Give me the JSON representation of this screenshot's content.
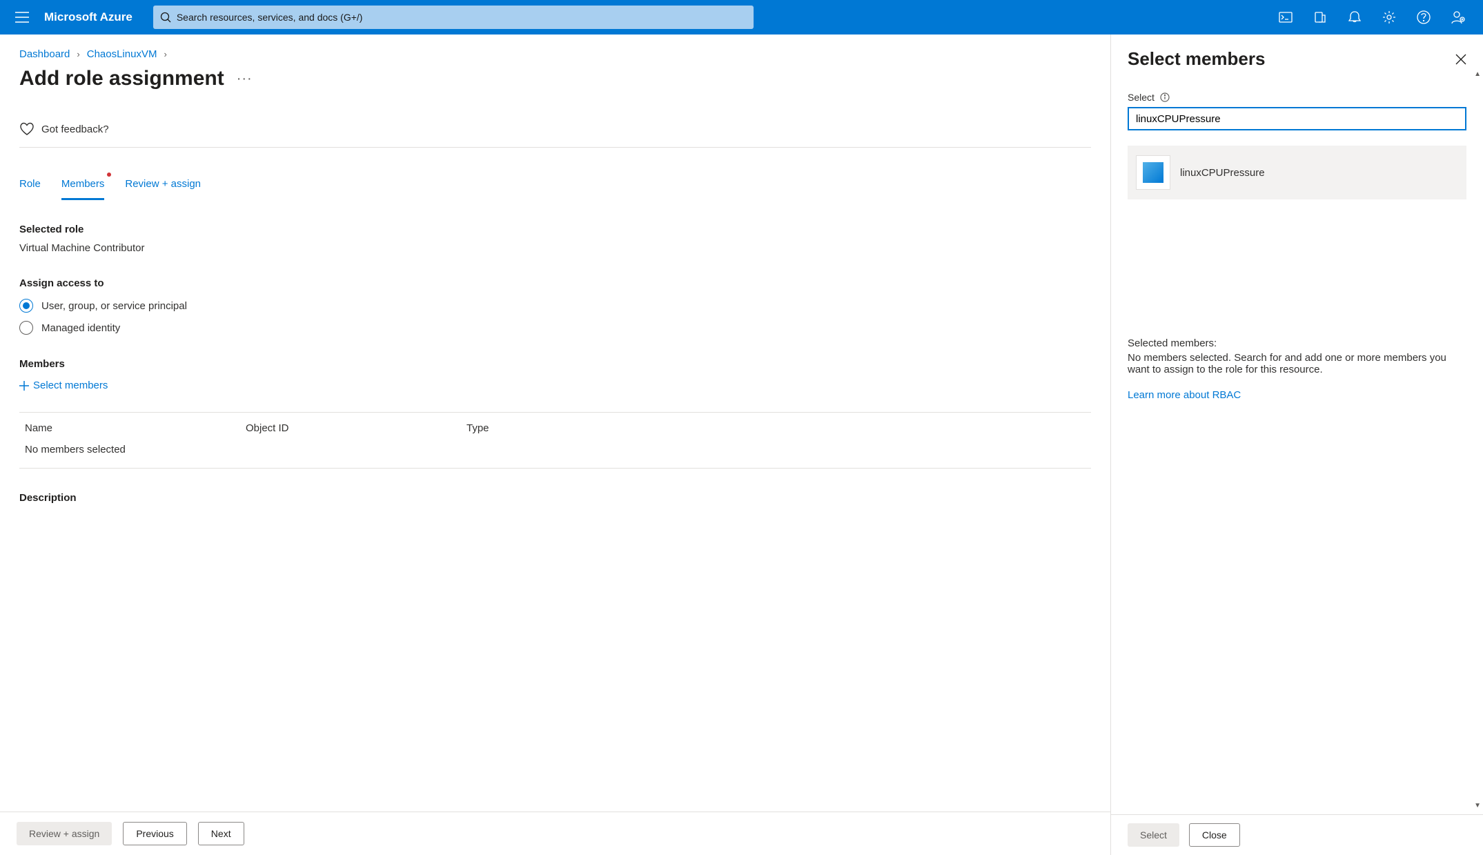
{
  "topbar": {
    "logo": "Microsoft Azure",
    "search_placeholder": "Search resources, services, and docs (G+/)"
  },
  "breadcrumbs": {
    "items": [
      "Dashboard",
      "ChaosLinuxVM"
    ]
  },
  "page": {
    "title": "Add role assignment",
    "feedback": "Got feedback?"
  },
  "tabs": {
    "items": [
      {
        "label": "Role",
        "active": false,
        "dot": false
      },
      {
        "label": "Members",
        "active": true,
        "dot": true
      },
      {
        "label": "Review + assign",
        "active": false,
        "dot": false
      }
    ]
  },
  "selected_role": {
    "heading": "Selected role",
    "value": "Virtual Machine Contributor"
  },
  "assign_access": {
    "heading": "Assign access to",
    "options": [
      {
        "label": "User, group, or service principal",
        "checked": true
      },
      {
        "label": "Managed identity",
        "checked": false
      }
    ]
  },
  "members": {
    "heading": "Members",
    "select_link": "Select members",
    "columns": {
      "name": "Name",
      "object_id": "Object ID",
      "type": "Type"
    },
    "empty": "No members selected"
  },
  "description": {
    "heading": "Description"
  },
  "footer": {
    "review": "Review + assign",
    "previous": "Previous",
    "next": "Next"
  },
  "panel": {
    "title": "Select members",
    "select_label": "Select",
    "input_value": "linuxCPUPressure",
    "result": "linuxCPUPressure",
    "selected_heading": "Selected members:",
    "selected_text": "No members selected. Search for and add one or more members you want to assign to the role for this resource.",
    "learn_link": "Learn more about RBAC",
    "footer_select": "Select",
    "footer_close": "Close"
  }
}
